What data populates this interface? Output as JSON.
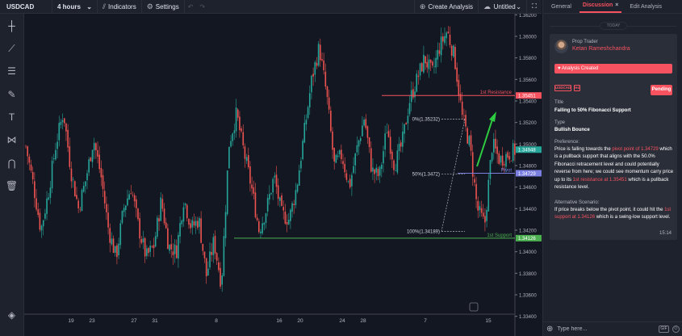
{
  "toolbar": {
    "symbol": "USDCAD",
    "interval": "4 hours",
    "indicators_label": "Indicators",
    "settings_label": "Settings",
    "create_analysis_label": "Create Analysis",
    "layout_name": "Untitled"
  },
  "icons": {
    "crosshair": "crosshair-icon",
    "trend_line": "trend-line-icon",
    "fib": "fib-retracement-icon",
    "brush": "brush-icon",
    "text": "text-icon",
    "pattern": "pattern-icon",
    "magnet": "magnet-icon",
    "trash": "trash-icon",
    "layers": "layers-icon"
  },
  "colors": {
    "up": "#26a69a",
    "down": "#ef5350",
    "resistance": "#f7525f",
    "support": "#4caf50",
    "pivot": "#7b7fe0",
    "arrow": "#2ecc40",
    "accent": "#f7525f"
  },
  "chart_data": {
    "type": "candlestick",
    "symbol": "USDCAD",
    "ylim": [
      1.3342,
      1.3621
    ],
    "y_ticks": [
      "1.36200",
      "1.36000",
      "1.35800",
      "1.35600",
      "1.35400",
      "1.35200",
      "1.35000",
      "1.34800",
      "1.34600",
      "1.34400",
      "1.34200",
      "1.34000",
      "1.33800",
      "1.33600",
      "1.33400"
    ],
    "x_ticks": [
      "19",
      "23",
      "27",
      "31",
      "8",
      "16",
      "20",
      "24",
      "28",
      "7",
      "15"
    ],
    "last_price": "1.34948",
    "levels": [
      {
        "label": "1st Resistance",
        "value": 1.35451,
        "tag": "1.35451"
      },
      {
        "label": "Pivot",
        "value": 1.34729,
        "tag": "1.34729"
      },
      {
        "label": "1st Support",
        "value": 1.34126,
        "tag": "1.34126"
      }
    ],
    "fibonacci": [
      {
        "label": "0%(1.35232)",
        "value": 1.35232
      },
      {
        "label": "50%(1.3472)",
        "value": 1.3472
      },
      {
        "label": "100%(1.34189)",
        "value": 1.34189
      }
    ],
    "path_points": [
      1.3498,
      1.3462,
      1.342,
      1.3455,
      1.35,
      1.353,
      1.3475,
      1.344,
      1.3468,
      1.3505,
      1.347,
      1.342,
      1.3395,
      1.344,
      1.346,
      1.3422,
      1.3395,
      1.3405,
      1.3448,
      1.3405,
      1.34,
      1.345,
      1.3422,
      1.343,
      1.3378,
      1.341,
      1.337,
      1.35,
      1.3528,
      1.3492,
      1.346,
      1.342,
      1.344,
      1.347,
      1.3435,
      1.343,
      1.346,
      1.351,
      1.356,
      1.359,
      1.3545,
      1.348,
      1.349,
      1.346,
      1.3495,
      1.3525,
      1.3475,
      1.347,
      1.3515,
      1.348,
      1.35,
      1.354,
      1.356,
      1.358,
      1.3565,
      1.359,
      1.3605,
      1.358,
      1.3525,
      1.35,
      1.344,
      1.3425,
      1.35,
      1.3485,
      1.349,
      1.3494
    ]
  },
  "panel": {
    "tabs": [
      "General",
      "Discussion",
      "Edit Analysis"
    ],
    "today_label": "TODAY",
    "author_role": "Prop Trader",
    "author_name": "Ketan Rameshchandra",
    "status": "Analysis Created",
    "tag_symbol": "USDCAD",
    "tag_timeframe": "H4",
    "pending_label": "Pending",
    "title_label": "Title",
    "title_value": "Falling to 50% Fibonacci Support",
    "type_label": "Type",
    "type_value": "Bullish Bounce",
    "preference_label": "Preference:",
    "preference_parts": [
      "Price is falling towards the ",
      "pivot point of 1.34729",
      " which is a pullback support that aligns with the 50.0% Fibonacci retracement level and could potentially reverse from here; we could see momentum carry price up to its ",
      "1st resistance at 1.35451",
      " which is a pullback resistance level."
    ],
    "alt_label": "Alternative Scenario:",
    "alt_parts": [
      "If price breaks below the pivot point, it could hit the ",
      "1st support at 1.34126",
      " which is a swing-low support level."
    ],
    "time": "15:14",
    "input_placeholder": "Type here...",
    "gif_label": "GIF"
  }
}
